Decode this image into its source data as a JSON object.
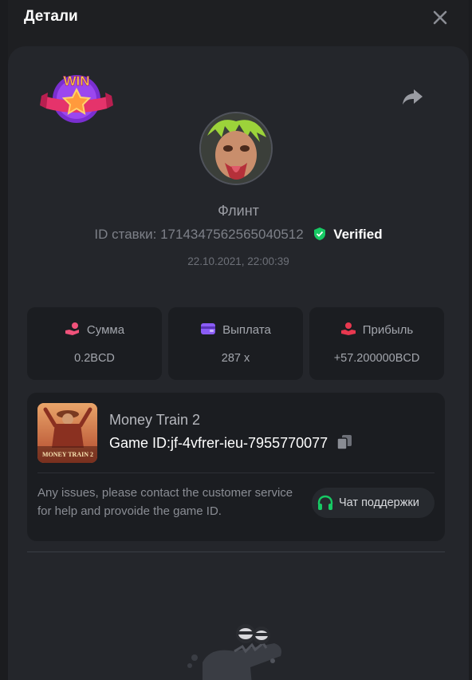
{
  "header": {
    "title": "Детали"
  },
  "player": {
    "name": "Флинт",
    "bet_id_label": "ID ставки:",
    "bet_id": "1714347562565040512",
    "verified_label": "Verified",
    "datetime": "22.10.2021, 22:00:39"
  },
  "badge": {
    "text": "WIN"
  },
  "stats": [
    {
      "label": "Сумма",
      "value": "0.2BCD",
      "icon": "coins-hand-icon"
    },
    {
      "label": "Выплата",
      "value": "287 x",
      "icon": "wallet-icon"
    },
    {
      "label": "Прибыль",
      "value": "+57.200000BCD",
      "icon": "profit-hand-icon"
    }
  ],
  "game": {
    "name": "Money Train 2",
    "id_label": "Game ID:",
    "id_value": "jf-4vfrer-ieu-7955770077",
    "thumb_text": "MONEY TRAIN 2",
    "help_text": "Any issues, please contact the customer service for help and provoide the game ID.",
    "chat_button": "Чат поддержки"
  },
  "colors": {
    "accent_green": "#17c964",
    "stat_icon_pink": "#f0527a",
    "stat_icon_purple": "#8a5cf6",
    "stat_icon_red": "#e8384f"
  }
}
